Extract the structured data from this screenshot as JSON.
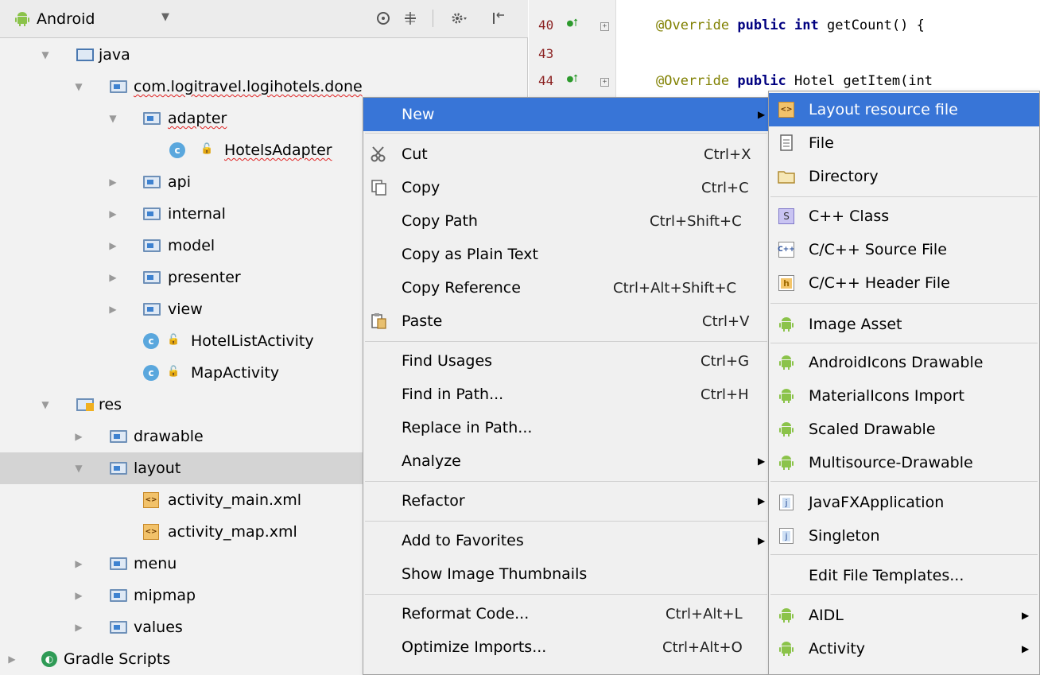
{
  "project_panel": {
    "view_selector": "Android",
    "tree": [
      {
        "label": "java"
      },
      {
        "label": "com.logitravel.logihotels.done"
      },
      {
        "label": "adapter"
      },
      {
        "label": "HotelsAdapter"
      },
      {
        "label": "api"
      },
      {
        "label": "internal"
      },
      {
        "label": "model"
      },
      {
        "label": "presenter"
      },
      {
        "label": "view"
      },
      {
        "label": "HotelListActivity"
      },
      {
        "label": "MapActivity"
      },
      {
        "label": "res"
      },
      {
        "label": "drawable"
      },
      {
        "label": "layout"
      },
      {
        "label": "activity_main.xml"
      },
      {
        "label": "activity_map.xml"
      },
      {
        "label": "menu"
      },
      {
        "label": "mipmap"
      },
      {
        "label": "values"
      },
      {
        "label": "Gradle Scripts"
      }
    ]
  },
  "editor": {
    "lines": [
      {
        "num": "40",
        "anno": "@Override",
        "kw": "public int",
        "rest": "getCount() {"
      },
      {
        "num": "43",
        "anno": "",
        "kw": "",
        "rest": ""
      },
      {
        "num": "44",
        "anno": "@Override",
        "kw": "public",
        "rest": "Hotel getItem(int"
      }
    ]
  },
  "context_menu": {
    "items": [
      {
        "label": "New",
        "shortcut": "",
        "submenu": true
      },
      {
        "label": "Cut",
        "shortcut": "Ctrl+X"
      },
      {
        "label": "Copy",
        "shortcut": "Ctrl+C"
      },
      {
        "label": "Copy Path",
        "shortcut": "Ctrl+Shift+C"
      },
      {
        "label": "Copy as Plain Text",
        "shortcut": ""
      },
      {
        "label": "Copy Reference",
        "shortcut": "Ctrl+Alt+Shift+C"
      },
      {
        "label": "Paste",
        "shortcut": "Ctrl+V"
      },
      {
        "label": "Find Usages",
        "shortcut": "Ctrl+G"
      },
      {
        "label": "Find in Path...",
        "shortcut": "Ctrl+H"
      },
      {
        "label": "Replace in Path...",
        "shortcut": ""
      },
      {
        "label": "Analyze",
        "shortcut": "",
        "submenu": true
      },
      {
        "label": "Refactor",
        "shortcut": "",
        "submenu": true
      },
      {
        "label": "Add to Favorites",
        "shortcut": "",
        "submenu": true
      },
      {
        "label": "Show Image Thumbnails",
        "shortcut": ""
      },
      {
        "label": "Reformat Code...",
        "shortcut": "Ctrl+Alt+L"
      },
      {
        "label": "Optimize Imports...",
        "shortcut": "Ctrl+Alt+O"
      }
    ]
  },
  "new_submenu": {
    "items": [
      {
        "label": "Layout resource file"
      },
      {
        "label": "File"
      },
      {
        "label": "Directory"
      },
      {
        "label": "C++ Class"
      },
      {
        "label": "C/C++ Source File"
      },
      {
        "label": "C/C++ Header File"
      },
      {
        "label": "Image Asset"
      },
      {
        "label": "AndroidIcons Drawable"
      },
      {
        "label": "MaterialIcons Import"
      },
      {
        "label": "Scaled Drawable"
      },
      {
        "label": "Multisource-Drawable"
      },
      {
        "label": "JavaFXApplication"
      },
      {
        "label": "Singleton"
      },
      {
        "label": "Edit File Templates..."
      },
      {
        "label": "AIDL"
      },
      {
        "label": "Activity"
      }
    ]
  },
  "colors": {
    "highlight": "#3875d7",
    "android_green": "#8bc34a",
    "selected_row": "#d4d4d4"
  }
}
